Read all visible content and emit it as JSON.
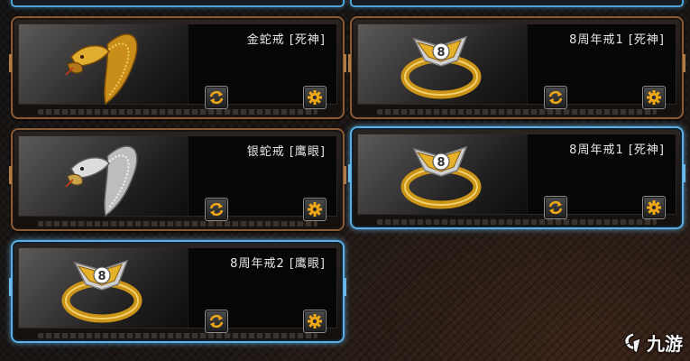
{
  "inventory": {
    "items": [
      {
        "name": "金蛇戒 [死神]",
        "icon": "gold-snake-ring-icon",
        "selected": false
      },
      {
        "name": "8周年戒1 [死神]",
        "icon": "anniversary-8-ring-icon",
        "selected": false
      },
      {
        "name": "银蛇戒 [鹰眼]",
        "icon": "silver-snake-ring-icon",
        "selected": false
      },
      {
        "name": "8周年戒1 [死神]",
        "icon": "anniversary-8-ring-icon",
        "selected": true
      },
      {
        "name": "8周年戒2 [鹰眼]",
        "icon": "anniversary-8-ring-icon",
        "selected": true
      }
    ],
    "buttons": {
      "swap": "swap-icon",
      "settings": "gear-icon"
    }
  },
  "ring_badge_text": "8",
  "watermark": {
    "text": "九游",
    "logo": "jiuyou-logo-icon"
  },
  "colors": {
    "frame_bronze": "#8a5a34",
    "frame_selected": "#5ab0e6",
    "gold": "#d9a521",
    "silver": "#d8d8d8",
    "button_icon": "#f0a818"
  }
}
